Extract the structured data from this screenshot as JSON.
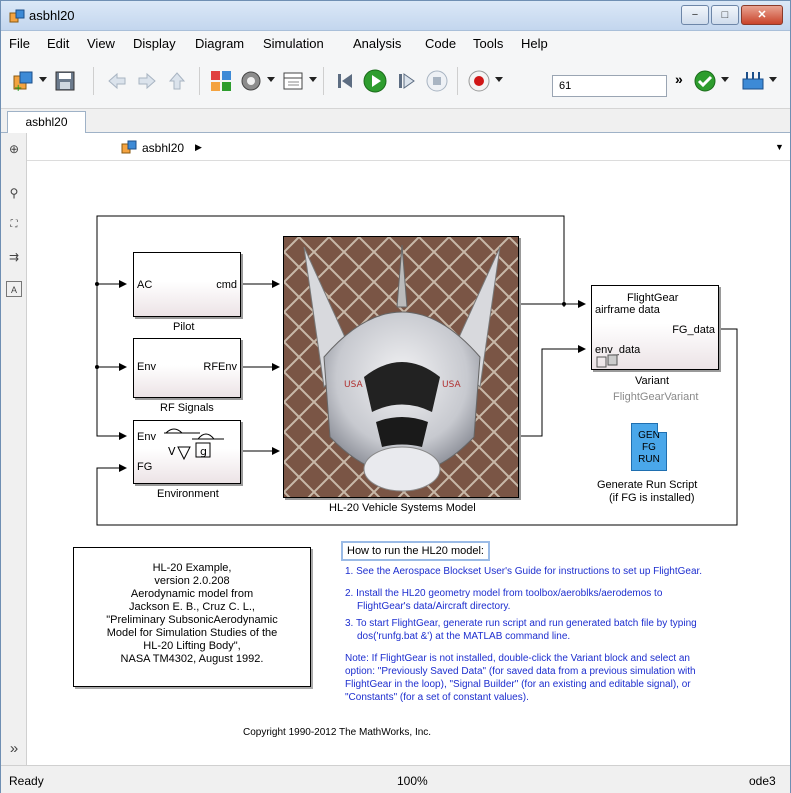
{
  "window": {
    "title": "asbhl20",
    "controls": {
      "minimize": "−",
      "maximize": "□",
      "close": "✕"
    }
  },
  "menu": [
    "File",
    "Edit",
    "View",
    "Display",
    "Diagram",
    "Simulation",
    "Analysis",
    "Code",
    "Tools",
    "Help"
  ],
  "toolbar": {
    "icons": [
      "new-model-icon",
      "save-icon",
      "back-icon",
      "forward-icon",
      "up-icon",
      "library-browser-icon",
      "model-config-icon",
      "model-explorer-icon",
      "step-back-icon",
      "run-icon",
      "step-forward-icon",
      "stop-icon",
      "record-icon",
      "overflow-icon",
      "model-advisor-icon",
      "build-icon"
    ],
    "stop_time": "61",
    "overflow": "»"
  },
  "tab": {
    "label": "asbhl20"
  },
  "breadcrumb": {
    "label": "asbhl20",
    "arrow": "▶",
    "menu": "▼"
  },
  "sidebar": {
    "icons": [
      "hide-browser-icon",
      "zoom-icon",
      "fit-to-view-icon",
      "arrow-icon",
      "annotation-icon"
    ],
    "collapse": "»"
  },
  "model": {
    "pilot": {
      "in": "AC",
      "out": "cmd",
      "name": "Pilot"
    },
    "rf": {
      "in": "Env",
      "out": "RFEnv",
      "name": "RF Signals"
    },
    "env": {
      "in1": "Env",
      "in2": "FG",
      "name": "Environment"
    },
    "vehicle": {
      "name": "HL-20 Vehicle Systems Model"
    },
    "flightgear": {
      "title": "FlightGear",
      "in1": "airframe data",
      "in2": "env_data",
      "out": "FG_data",
      "name": "Variant",
      "subname": "FlightGearVariant"
    },
    "script": {
      "line1": "GEN",
      "line2": "FG",
      "line3": "RUN",
      "caption1": "Generate Run Script",
      "caption2": "(if FG is installed)"
    }
  },
  "note": {
    "lines": [
      "HL-20 Example,",
      "version 2.0.208",
      "Aerodynamic model from",
      "Jackson E. B., Cruz C. L.,",
      "\"Preliminary SubsonicAerodynamic",
      "Model for Simulation Studies of the",
      "HL-20 Lifting Body\",",
      "NASA TM4302, August 1992."
    ]
  },
  "howto": {
    "title": "How to run the HL20 model:",
    "step1": "1. See the Aerospace Blockset User's Guide for instructions to set up FlightGear.",
    "step2a": "2. Install the HL20 geometry model from toolbox/aeroblks/aerodemos to",
    "step2b": "FlightGear's data/Aircraft directory.",
    "step3a": "3. To start FlightGear, generate run script and run generated batch file by typing",
    "step3b": "dos('runfg.bat &') at the MATLAB command line.",
    "note1": "Note: If FlightGear is not installed, double-click the Variant block and select an",
    "note2": "option: \"Previously Saved Data\" (for saved data from a previous simulation with",
    "note3": "FlightGear in the loop), \"Signal Builder\" (for an existing and editable signal), or",
    "note4": "\"Constants\" (for a set of constant values)."
  },
  "copyright": "Copyright 1990-2012 The MathWorks, Inc.",
  "status": {
    "left": "Ready",
    "zoom": "100%",
    "solver": "ode3"
  },
  "colors": {
    "title_gradient": "#c3d6ee",
    "link_blue": "#1d2ecf",
    "run_green": "#2e9d2e",
    "record_red": "#d01515",
    "script_icon": "#4aa7ea"
  }
}
